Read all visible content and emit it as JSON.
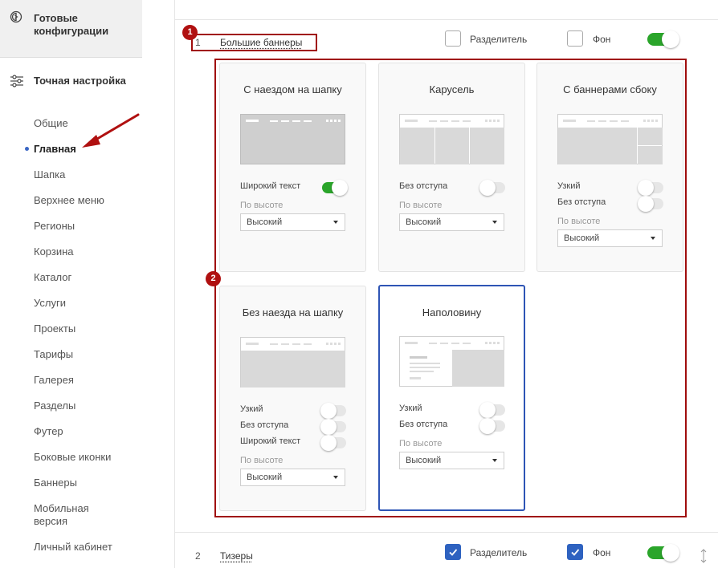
{
  "sidebar": {
    "ready_configs": "Готовые конфигурации",
    "fine_tuning": "Точная настройка",
    "items": [
      {
        "label": "Общие"
      },
      {
        "label": "Главная",
        "active": true
      },
      {
        "label": "Шапка"
      },
      {
        "label": "Верхнее меню"
      },
      {
        "label": "Регионы"
      },
      {
        "label": "Корзина"
      },
      {
        "label": "Каталог"
      },
      {
        "label": "Услуги"
      },
      {
        "label": "Проекты"
      },
      {
        "label": "Тарифы"
      },
      {
        "label": "Галерея"
      },
      {
        "label": "Разделы"
      },
      {
        "label": "Футер"
      },
      {
        "label": "Боковые иконки"
      },
      {
        "label": "Баннеры"
      },
      {
        "label": "Мобильная версия"
      },
      {
        "label": "Личный кабинет"
      }
    ]
  },
  "rows": [
    {
      "num": "1",
      "name": "Большие баннеры",
      "separator_label": "Разделитель",
      "separator_checked": false,
      "bg_label": "Фон",
      "bg_checked": false,
      "enabled": true
    },
    {
      "num": "2",
      "name": "Тизеры",
      "separator_label": "Разделитель",
      "separator_checked": true,
      "bg_label": "Фон",
      "bg_checked": true,
      "enabled": true
    }
  ],
  "cards": [
    {
      "title": "С наездом на шапку",
      "options": [
        {
          "label": "Широкий текст",
          "on": true
        }
      ],
      "height_label": "По высоте",
      "height_value": "Высокий"
    },
    {
      "title": "Карусель",
      "options": [
        {
          "label": "Без отступа",
          "on": false
        }
      ],
      "height_label": "По высоте",
      "height_value": "Высокий"
    },
    {
      "title": "С баннерами сбоку",
      "options": [
        {
          "label": "Узкий",
          "on": false
        },
        {
          "label": "Без отступа",
          "on": false
        }
      ],
      "height_label": "По высоте",
      "height_value": "Высокий"
    },
    {
      "title": "Без наезда на шапку",
      "options": [
        {
          "label": "Узкий",
          "on": false
        },
        {
          "label": "Без отступа",
          "on": false
        },
        {
          "label": "Широкий текст",
          "on": false
        }
      ],
      "height_label": "По высоте",
      "height_value": "Высокий"
    },
    {
      "title": "Наполовину",
      "selected": true,
      "options": [
        {
          "label": "Узкий",
          "on": false
        },
        {
          "label": "Без отступа",
          "on": false
        }
      ],
      "height_label": "По высоте",
      "height_value": "Высокий"
    }
  ],
  "annotations": {
    "badge1": "1",
    "badge2": "2"
  },
  "colors": {
    "accent": "#2e62c0",
    "toggle_on": "#2aa52a",
    "annotation_red": "#a00d0d",
    "selected_border": "#2e55b5"
  }
}
